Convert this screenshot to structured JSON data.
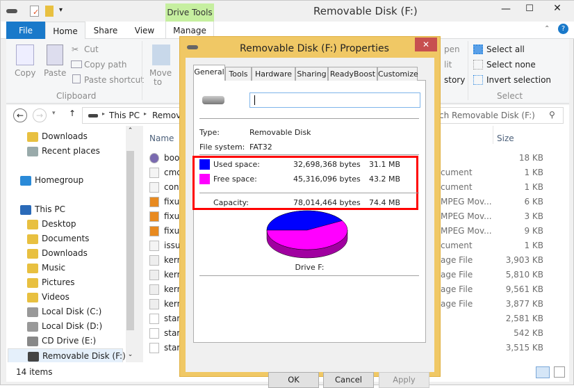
{
  "window": {
    "title": "Removable Disk (F:)",
    "context_tab": "Drive Tools"
  },
  "qat": {
    "icons": [
      "drive-icon",
      "properties-icon",
      "new-folder-icon",
      "customize-dropdown-icon"
    ]
  },
  "tabs": [
    "File",
    "Home",
    "Share",
    "View",
    "Manage"
  ],
  "ribbon": {
    "clipboard": {
      "copy": "Copy",
      "paste": "Paste",
      "cut": "Cut",
      "copy_path": "Copy path",
      "paste_shortcut": "Paste shortcut",
      "group": "Clipboard"
    },
    "move_to": "Move",
    "move_to2": "to",
    "open_partial": "pen",
    "edit_partial": "lit",
    "history_partial": "story",
    "select": {
      "all": "Select all",
      "none": "Select none",
      "invert": "Invert selection",
      "group": "Select"
    }
  },
  "address": {
    "crumbs": [
      "This PC",
      "Remova"
    ],
    "search_placeholder": "ch Removable Disk (F:)"
  },
  "nav": [
    {
      "label": "Downloads",
      "icon": "downloads-folder"
    },
    {
      "label": "Recent places",
      "icon": "recent-places"
    },
    {
      "label": "Homegroup",
      "icon": "homegroup"
    },
    {
      "label": "This PC",
      "icon": "computer"
    },
    {
      "label": "Desktop",
      "icon": "folder"
    },
    {
      "label": "Documents",
      "icon": "folder"
    },
    {
      "label": "Downloads",
      "icon": "folder"
    },
    {
      "label": "Music",
      "icon": "folder"
    },
    {
      "label": "Pictures",
      "icon": "folder"
    },
    {
      "label": "Videos",
      "icon": "folder"
    },
    {
      "label": "Local Disk (C:)",
      "icon": "drive"
    },
    {
      "label": "Local Disk (D:)",
      "icon": "drive"
    },
    {
      "label": "CD Drive (E:)",
      "icon": "cd-drive"
    },
    {
      "label": "Removable Disk (F:)",
      "icon": "removable-drive"
    }
  ],
  "columns": {
    "name": "Name",
    "size": "Size"
  },
  "files": [
    {
      "name": "boot",
      "type": "",
      "size": "18 KB",
      "icon": "disc"
    },
    {
      "name": "cmd",
      "type": "cument",
      "size": "1 KB",
      "icon": "text"
    },
    {
      "name": "conf",
      "type": "cument",
      "size": "1 KB",
      "icon": "text"
    },
    {
      "name": "fixup",
      "type": "MPEG Mov...",
      "size": "6 KB",
      "icon": "dat"
    },
    {
      "name": "fixup",
      "type": "MPEG Mov...",
      "size": "3 KB",
      "icon": "dat"
    },
    {
      "name": "fixup",
      "type": "MPEG Mov...",
      "size": "9 KB",
      "icon": "dat"
    },
    {
      "name": "issue",
      "type": "cument",
      "size": "1 KB",
      "icon": "text"
    },
    {
      "name": "kern",
      "type": "age File",
      "size": "3,903 KB",
      "icon": "image"
    },
    {
      "name": "kern",
      "type": "age File",
      "size": "5,810 KB",
      "icon": "image"
    },
    {
      "name": "kern",
      "type": "age File",
      "size": "9,561 KB",
      "icon": "image"
    },
    {
      "name": "kern",
      "type": "age File",
      "size": "3,877 KB",
      "icon": "image"
    },
    {
      "name": "start",
      "type": "",
      "size": "2,581 KB",
      "icon": "file"
    },
    {
      "name": "start",
      "type": "",
      "size": "542 KB",
      "icon": "file"
    },
    {
      "name": "start",
      "type": "",
      "size": "3,515 KB",
      "icon": "file"
    }
  ],
  "status": {
    "items": "14 items"
  },
  "dialog": {
    "title": "Removable Disk (F:) Properties",
    "close": "✕",
    "tabs": [
      "General",
      "Tools",
      "Hardware",
      "Sharing",
      "ReadyBoost",
      "Customize"
    ],
    "label_value": "",
    "type_label": "Type:",
    "type_value": "Removable Disk",
    "fs_label": "File system:",
    "fs_value": "FAT32",
    "used_label": "Used space:",
    "used_bytes": "32,698,368 bytes",
    "used_mb": "31.1 MB",
    "free_label": "Free space:",
    "free_bytes": "45,316,096 bytes",
    "free_mb": "43.2 MB",
    "cap_label": "Capacity:",
    "cap_bytes": "78,014,464 bytes",
    "cap_mb": "74.4 MB",
    "drive_label": "Drive F:",
    "used_fraction": 0.419,
    "colors": {
      "used": "#0000ff",
      "free": "#ff00ff",
      "free_side": "#a000a0",
      "highlight": "#ff0000"
    },
    "ok": "OK",
    "cancel": "Cancel",
    "apply": "Apply"
  }
}
